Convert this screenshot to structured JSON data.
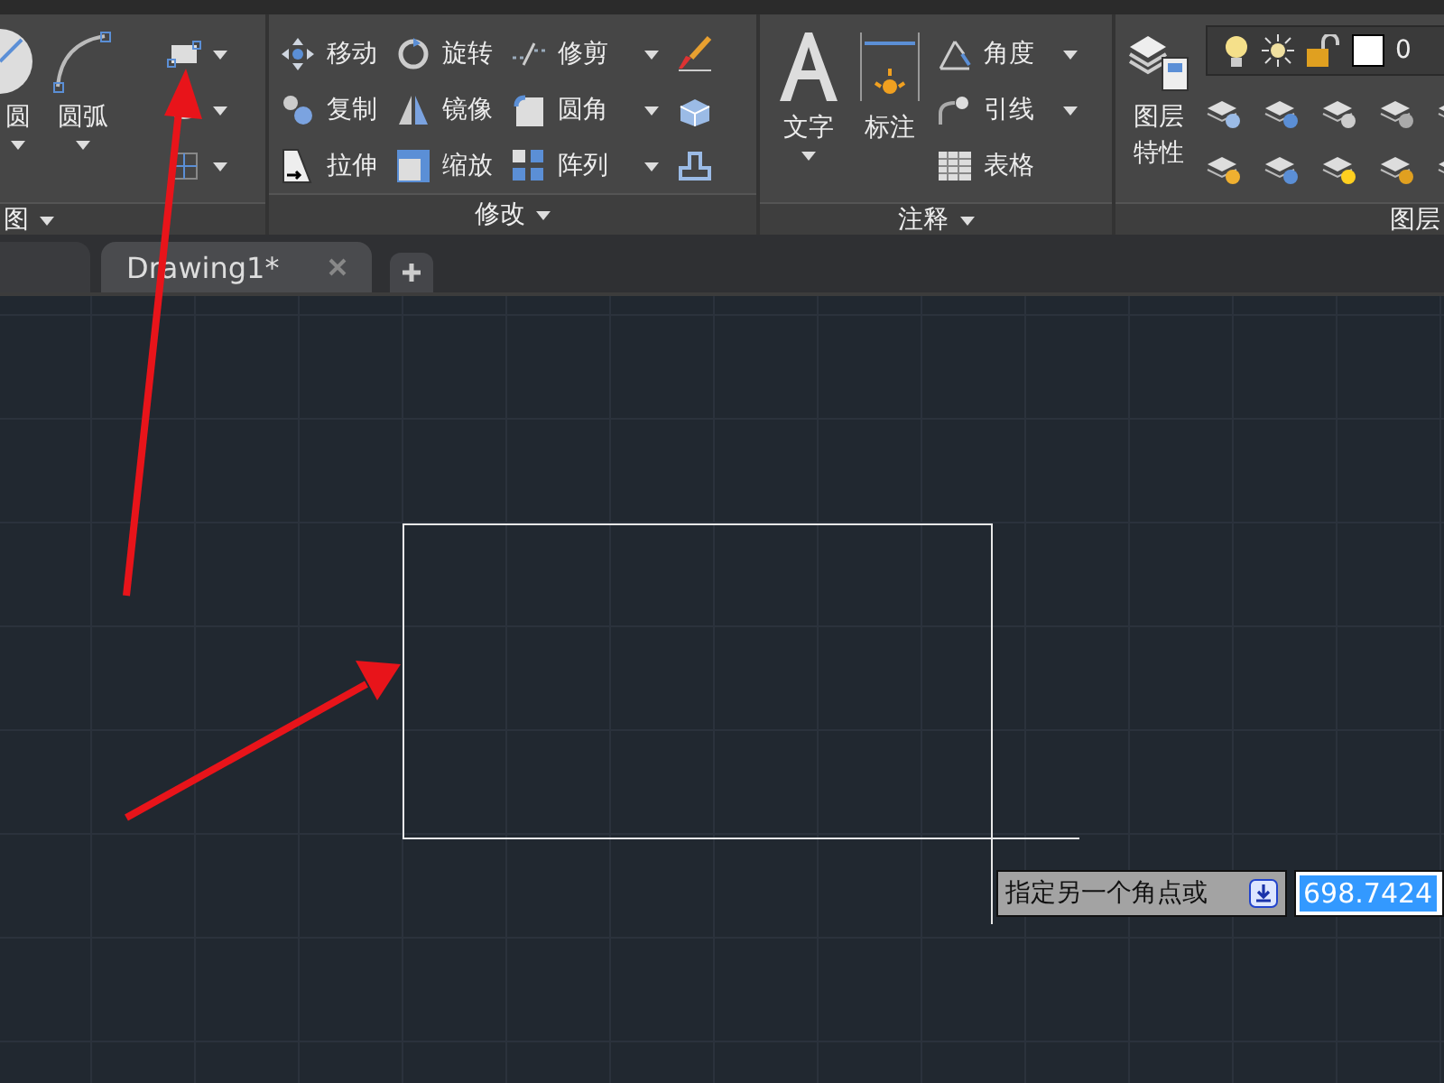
{
  "draw_panel": {
    "title": "图",
    "large_tools": [
      {
        "label": "圆"
      },
      {
        "label": "圆弧"
      }
    ],
    "small_tools": [
      {
        "dropdown": true
      },
      {
        "dropdown": true
      },
      {
        "dropdown": true
      }
    ]
  },
  "modify_panel": {
    "title": "修改",
    "tools": [
      {
        "label": "移动",
        "dropdown": false
      },
      {
        "label": "旋转",
        "dropdown": false
      },
      {
        "label": "修剪",
        "dropdown": true
      },
      {
        "label": "复制",
        "dropdown": false
      },
      {
        "label": "镜像",
        "dropdown": false
      },
      {
        "label": "圆角",
        "dropdown": true
      },
      {
        "label": "拉伸",
        "dropdown": false
      },
      {
        "label": "缩放",
        "dropdown": false
      },
      {
        "label": "阵列",
        "dropdown": true
      }
    ]
  },
  "annotation_panel": {
    "title": "注释",
    "large_tools": [
      {
        "label": "文字",
        "dropdown": true
      },
      {
        "label": "标注",
        "dropdown": false
      }
    ],
    "tools": [
      {
        "label": "角度",
        "dropdown": true
      },
      {
        "label": "引线",
        "dropdown": true
      },
      {
        "label": "表格",
        "dropdown": false
      }
    ]
  },
  "layers_panel": {
    "title": "图层",
    "large_tool": {
      "label": "图层特性"
    },
    "current_layer": "0"
  },
  "file_tabs": [
    {
      "label": "Drawing1*",
      "selected": true
    }
  ],
  "command_tooltip": {
    "prompt": "指定另一个角点或",
    "value": "698.7424"
  }
}
